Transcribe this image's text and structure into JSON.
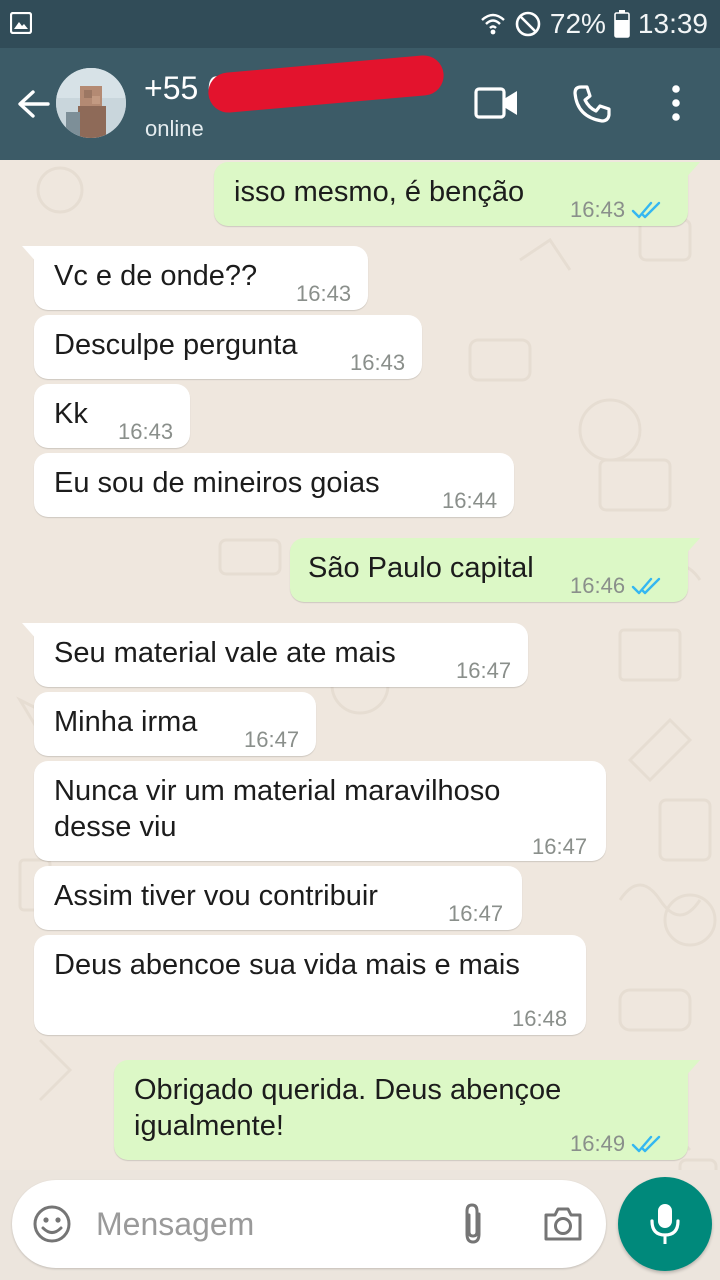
{
  "status_bar": {
    "battery": "72%",
    "time": "13:39"
  },
  "header": {
    "contact_name": "+55 62 9",
    "status": "online"
  },
  "messages": [
    {
      "dir": "out",
      "text": "isso mesmo, é benção",
      "time": "16:43",
      "read": true
    },
    {
      "dir": "in",
      "text": "Vc e de onde??",
      "time": "16:43"
    },
    {
      "dir": "in",
      "text": "Desculpe pergunta",
      "time": "16:43"
    },
    {
      "dir": "in",
      "text": "Kk",
      "time": "16:43"
    },
    {
      "dir": "in",
      "text": "Eu sou de mineiros goias",
      "time": "16:44"
    },
    {
      "dir": "out",
      "text": "São Paulo capital",
      "time": "16:46",
      "read": true
    },
    {
      "dir": "in",
      "text": "Seu material vale ate mais",
      "time": "16:47"
    },
    {
      "dir": "in",
      "text": "Minha irma",
      "time": "16:47"
    },
    {
      "dir": "in",
      "text": "Nunca vir um material maravilhoso",
      "text_line2": "desse viu",
      "time": "16:47"
    },
    {
      "dir": "in",
      "text": "Assim tiver vou contribuir",
      "time": "16:47"
    },
    {
      "dir": "in",
      "text": "Deus abencoe sua vida mais e mais",
      "time": "16:48"
    },
    {
      "dir": "out",
      "text": "Obrigado querida. Deus abençoe",
      "text_line2": "igualmente!",
      "time": "16:49",
      "read": true
    }
  ],
  "composer": {
    "placeholder": "Mensagem"
  },
  "colors": {
    "header": "#3c5b67",
    "status_bar": "#314c58",
    "outgoing": "#dcf8c6",
    "incoming": "#ffffff",
    "mic": "#00897b",
    "read_ticks": "#34b7f1"
  }
}
